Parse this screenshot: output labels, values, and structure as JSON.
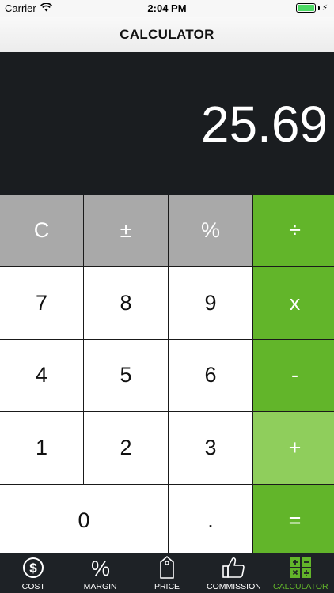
{
  "status_bar": {
    "carrier": "Carrier",
    "time": "2:04 PM"
  },
  "nav": {
    "title": "CALCULATOR"
  },
  "display": {
    "value": "25.69"
  },
  "keys": {
    "clear": "C",
    "sign": "±",
    "percent": "%",
    "divide": "÷",
    "seven": "7",
    "eight": "8",
    "nine": "9",
    "multiply": "x",
    "four": "4",
    "five": "5",
    "six": "6",
    "subtract": "-",
    "one": "1",
    "two": "2",
    "three": "3",
    "add": "+",
    "zero": "0",
    "decimal": ".",
    "equals": "="
  },
  "tabs": [
    {
      "label": "COST",
      "icon": "dollar-icon"
    },
    {
      "label": "MARGIN",
      "icon": "percent-icon"
    },
    {
      "label": "PRICE",
      "icon": "price-tag-icon"
    },
    {
      "label": "COMMISSION",
      "icon": "thumbs-up-icon"
    },
    {
      "label": "CALCULATOR",
      "icon": "calculator-icon",
      "active": true
    }
  ],
  "colors": {
    "accent": "#62b52a",
    "accent_light": "#8fce5c",
    "display_bg": "#1a1d20",
    "function_key": "#a9a9a9",
    "tab_bar_bg": "#1e2226"
  }
}
